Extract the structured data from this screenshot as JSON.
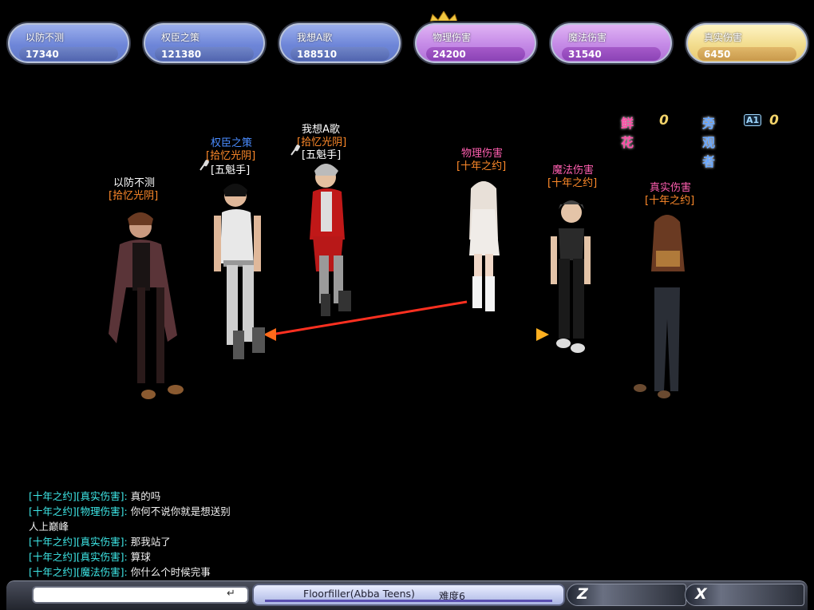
{
  "players": [
    {
      "name": "以防不测",
      "score": "17340",
      "team": "blue"
    },
    {
      "name": "权臣之策",
      "score": "121380",
      "team": "blue"
    },
    {
      "name": "我想A歌",
      "score": "188510",
      "team": "blue"
    },
    {
      "name": "物理伤害",
      "score": "24200",
      "team": "purple"
    },
    {
      "name": "魔法伤害",
      "score": "31540",
      "team": "purple"
    },
    {
      "name": "真实伤害",
      "score": "6450",
      "team": "gold"
    }
  ],
  "counters": {
    "flowers_label": "鲜花",
    "flowers_value": "0",
    "spectators_label": "旁观者",
    "spectators_badge": "A1",
    "spectators_value": "0"
  },
  "characters": [
    {
      "name": "以防不测",
      "guild": "[拾忆光阴]",
      "name_color": "#ffffff"
    },
    {
      "name": "权臣之策",
      "guild": "[拾忆光阴]",
      "title": "[五魁手]",
      "name_color": "#4a8cff"
    },
    {
      "name": "我想A歌",
      "guild": "[拾忆光阴]",
      "title": "[五魁手]",
      "name_color": "#ffffff"
    },
    {
      "name": "物理伤害",
      "guild": "[十年之约]",
      "name_color": "#ff5fb0"
    },
    {
      "name": "魔法伤害",
      "guild": "[十年之约]",
      "name_color": "#ff5fb0"
    },
    {
      "name": "真实伤害",
      "guild": "[十年之约]",
      "name_color": "#ff5fb0"
    }
  ],
  "chat": [
    {
      "channel": "[十年之约][真实伤害]:",
      "text": "真的吗"
    },
    {
      "channel": "[十年之约][物理伤害]:",
      "text": "你何不说你就是想送别"
    },
    {
      "channel": "",
      "text": "人上巅峰"
    },
    {
      "channel": "[十年之约][真实伤害]:",
      "text": "那我站了"
    },
    {
      "channel": "[十年之约][真实伤害]:",
      "text": "算球"
    },
    {
      "channel": "[十年之约][魔法伤害]:",
      "text": "你什么个时候完事"
    }
  ],
  "bottom": {
    "input_value": "",
    "song": "Floorfiller(Abba Teens)",
    "difficulty": "难度6",
    "key1": "Z",
    "key2": "X"
  },
  "colors": {
    "blue_plate": "#7f95e0",
    "purple_plate": "#c889e8",
    "gold_plate": "#f2dc8e",
    "guild_orange": "#ff8a2a",
    "chat_channel": "#3ee8e8"
  }
}
